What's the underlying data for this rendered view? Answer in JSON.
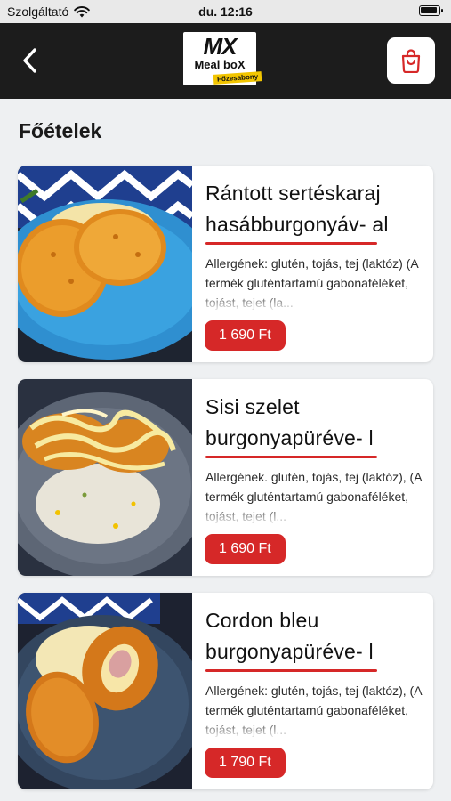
{
  "status_bar": {
    "carrier": "Szolgáltató",
    "time": "du. 12:16"
  },
  "header": {
    "logo": {
      "mx": "MX",
      "meal_box": "Meal boX",
      "tag": "Főzesabony"
    }
  },
  "section": {
    "title": "Főételek"
  },
  "products": [
    {
      "title": "Rántott sertéskaraj hasábburgonyáv- al",
      "description": "Allergének: glutén, tojás, tej (laktóz) (A termék gluténtartamú gabonaféléket, tojást, tejet (la...",
      "price": "1 690 Ft"
    },
    {
      "title": "Sisi szelet burgonyapüréve- l",
      "description": "Allergének. glutén, tojás, tej (laktóz), (A termék gluténtartamú gabonaféléket, tojást, tejet (l...",
      "price": "1 690 Ft"
    },
    {
      "title": "Cordon bleu burgonyapüréve- l",
      "description": "Allergének: glutén, tojás, tej (laktóz), (A termék gluténtartamú gabonaféléket, tojást, tejet (l...",
      "price": "1 790 Ft"
    }
  ],
  "colors": {
    "accent": "#d62828",
    "header_bg": "#1c1c1c",
    "page_bg": "#eef0f2"
  },
  "icons": {
    "back": "chevron-left-icon",
    "cart": "shopping-bag-icon",
    "wifi": "wifi-icon",
    "battery": "battery-icon"
  }
}
